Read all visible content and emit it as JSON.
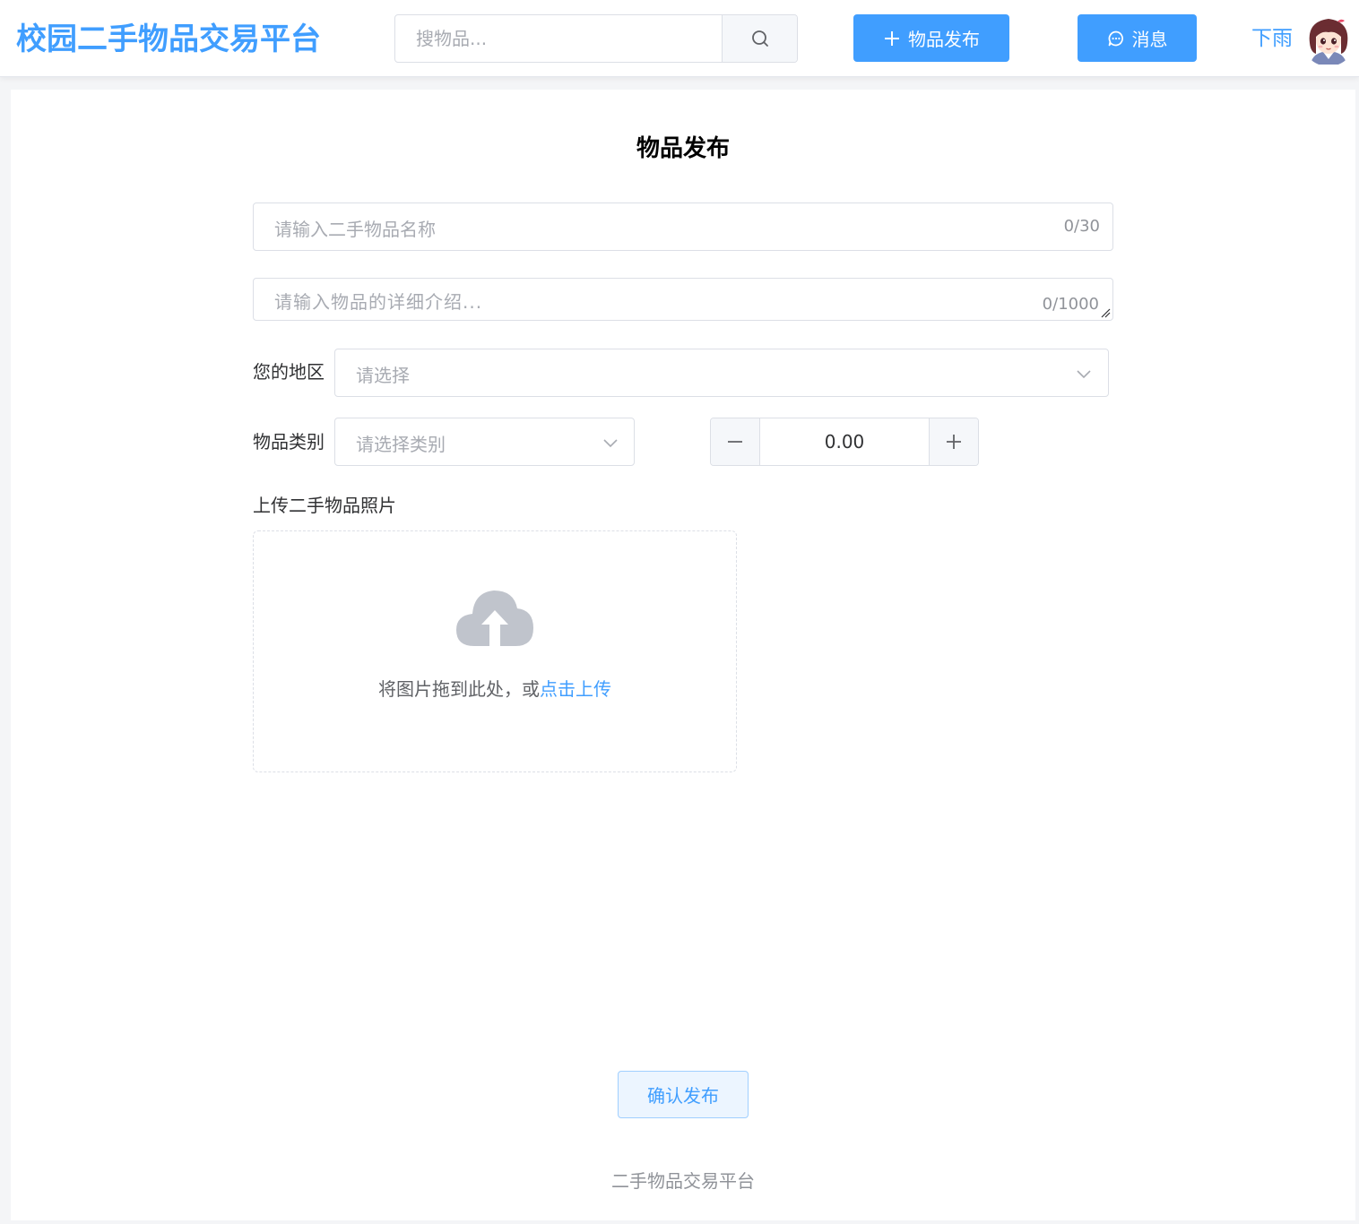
{
  "header": {
    "logo": "校园二手物品交易平台",
    "search_placeholder": "搜物品...",
    "publish_label": "物品发布",
    "message_label": "消息",
    "username": "下雨"
  },
  "form": {
    "title": "物品发布",
    "name_placeholder": "请输入二手物品名称",
    "name_count": "0/30",
    "desc_placeholder": "请输入物品的详细介绍...",
    "desc_count": "0/1000",
    "region_label": "您的地区",
    "region_placeholder": "请选择",
    "category_label": "物品类别",
    "category_placeholder": "请选择类别",
    "price_value": "0.00",
    "upload_label": "上传二手物品照片",
    "upload_text": "将图片拖到此处，或",
    "upload_link": "点击上传",
    "confirm_label": "确认发布"
  },
  "footer": {
    "text": "二手物品交易平台"
  },
  "colors": {
    "primary": "#409eff",
    "placeholder": "#a8abb2",
    "border": "#dcdfe6"
  }
}
